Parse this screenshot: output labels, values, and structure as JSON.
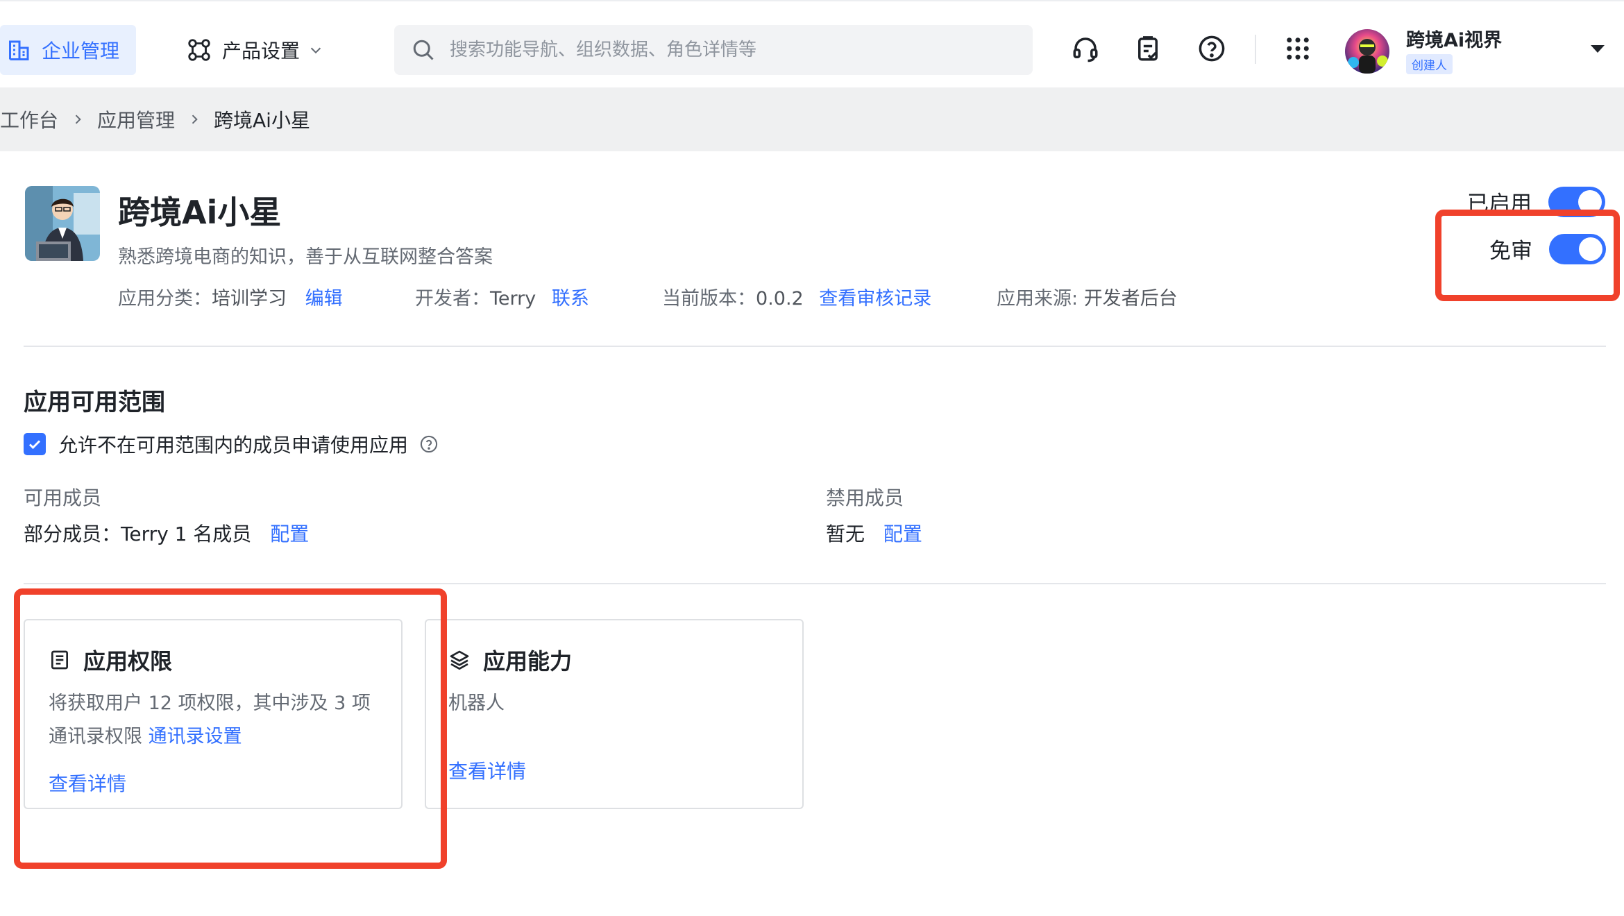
{
  "nav": {
    "enterprise_label": "企业管理",
    "product_label": "产品设置",
    "search_placeholder": "搜索功能导航、组织数据、角色详情等"
  },
  "user": {
    "name": "跨境Ai视界",
    "role": "创建人"
  },
  "breadcrumb": {
    "items": [
      "工作台",
      "应用管理",
      "跨境Ai小星"
    ]
  },
  "app": {
    "name": "跨境Ai小星",
    "description": "熟悉跨境电商的知识，善于从互联网整合答案",
    "category_label": "应用分类：",
    "category_value": "培训学习",
    "edit_label": "编辑",
    "developer_label": "开发者：",
    "developer_value": "Terry",
    "contact_label": "联系",
    "version_label": "当前版本：",
    "version_value": "0.0.2",
    "audit_link": "查看审核记录",
    "source_label": "应用来源: ",
    "source_value": "开发者后台",
    "enabled_label": "已启用",
    "exempt_label": "免审"
  },
  "scope": {
    "title": "应用可用范围",
    "allow_apply_label": "允许不在可用范围内的成员申请使用应用",
    "available_label": "可用成员",
    "available_value": "部分成员：Terry 1 名成员",
    "available_config": "配置",
    "banned_label": "禁用成员",
    "banned_value": "暂无",
    "banned_config": "配置"
  },
  "cards": {
    "permission": {
      "title": "应用权限",
      "text_line1": "将获取用户 12 项权限，其中涉及 3 项",
      "text_line2": "通讯录权限",
      "contacts_link": "通讯录设置",
      "details_link": "查看详情"
    },
    "capability": {
      "title": "应用能力",
      "text": "机器人",
      "details_link": "查看详情"
    }
  },
  "colors": {
    "accent": "#3370ff",
    "annotation": "#f0412b"
  }
}
